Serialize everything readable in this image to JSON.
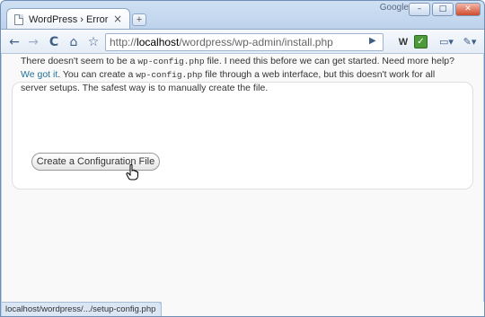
{
  "browser": {
    "tab_title": "WordPress › Error",
    "tab_close": "×",
    "new_tab": "+",
    "brand": "Google",
    "controls": {
      "minimize": "–",
      "maximize": "□",
      "close": "✕"
    }
  },
  "toolbar": {
    "back": "←",
    "forward": "→",
    "reload": "C",
    "home": "⌂",
    "bookmark": "☆",
    "url_scheme": "http://",
    "url_host": "localhost",
    "url_path": "/wordpress/wp-admin/install.php",
    "go": "▶",
    "ext1": "W",
    "ext2": "✓",
    "page_menu": "▭▾",
    "tools_menu": "✎▾"
  },
  "page": {
    "message_part1": "There doesn't seem to be a ",
    "config_file": "wp-config.php",
    "message_part2": " file. I need this before we can get started. Need more help? ",
    "help_link": "We got it",
    "message_part3": ". You can create a ",
    "message_part4": " file through a web interface, but this doesn't work for all server setups. The safest way is to manually create the file.",
    "button_label": "Create a Configuration File"
  },
  "status": {
    "hover_url": "localhost/wordpress/.../setup-config.php"
  }
}
